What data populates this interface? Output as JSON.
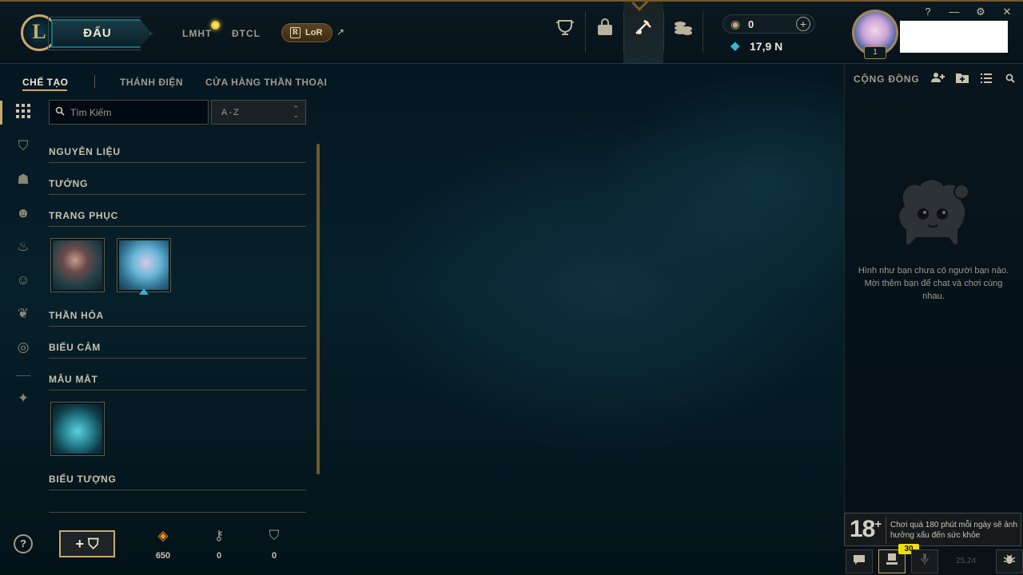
{
  "topbar": {
    "logo_letter": "L",
    "play_label": "ĐẤU",
    "game_tabs": [
      "LMHT",
      "ĐTCL"
    ],
    "lor_label": "LoR",
    "lor_icon": "R",
    "external_icon": "↗",
    "nav_icons": [
      "trophy-icon",
      "bag-icon",
      "crafting-icon",
      "store-icon"
    ],
    "rp_value": "0",
    "be_value": "17,9 N",
    "level": "1",
    "window_controls": [
      "?",
      "—",
      "⚙",
      "✕"
    ]
  },
  "tabs": [
    "CHẾ TẠO",
    "THÁNH ĐIỆN",
    "CỬA HÀNG THẦN THOẠI"
  ],
  "filters": {
    "search_placeholder": "Tìm Kiếm",
    "sort_value": "A-Z"
  },
  "sections": {
    "materials": "NGUYÊN LIỆU",
    "champions": "TƯỚNG",
    "skins": "TRANG PHỤC",
    "wards": "THẦN HỎA",
    "emotes": "BIỂU CẢM",
    "eyes": "MẪU MẮT",
    "icons": "BIỂU TƯỢNG"
  },
  "bottom": {
    "help": "?",
    "add_chest": "+ ⛉",
    "orange_essence": "650",
    "keys": "0",
    "chests": "0"
  },
  "social": {
    "title": "CỘNG ĐỒNG",
    "empty_text": "Hình như bạn chưa có người bạn nào. Mời thêm bạn để chat và chơi cùng nhau."
  },
  "age_notice": {
    "age": "18",
    "plus": "+",
    "text": "Chơi quá 180 phút mỗi ngày sẽ ảnh hưởng xấu đến sức khỏe"
  },
  "footer": {
    "badge": "30",
    "version": "25.24"
  },
  "colors": {
    "gold": "#c8aa6e",
    "blue_essence": "#38b8d0",
    "orange_essence": "#f0902a",
    "notification": "#f0e000"
  }
}
